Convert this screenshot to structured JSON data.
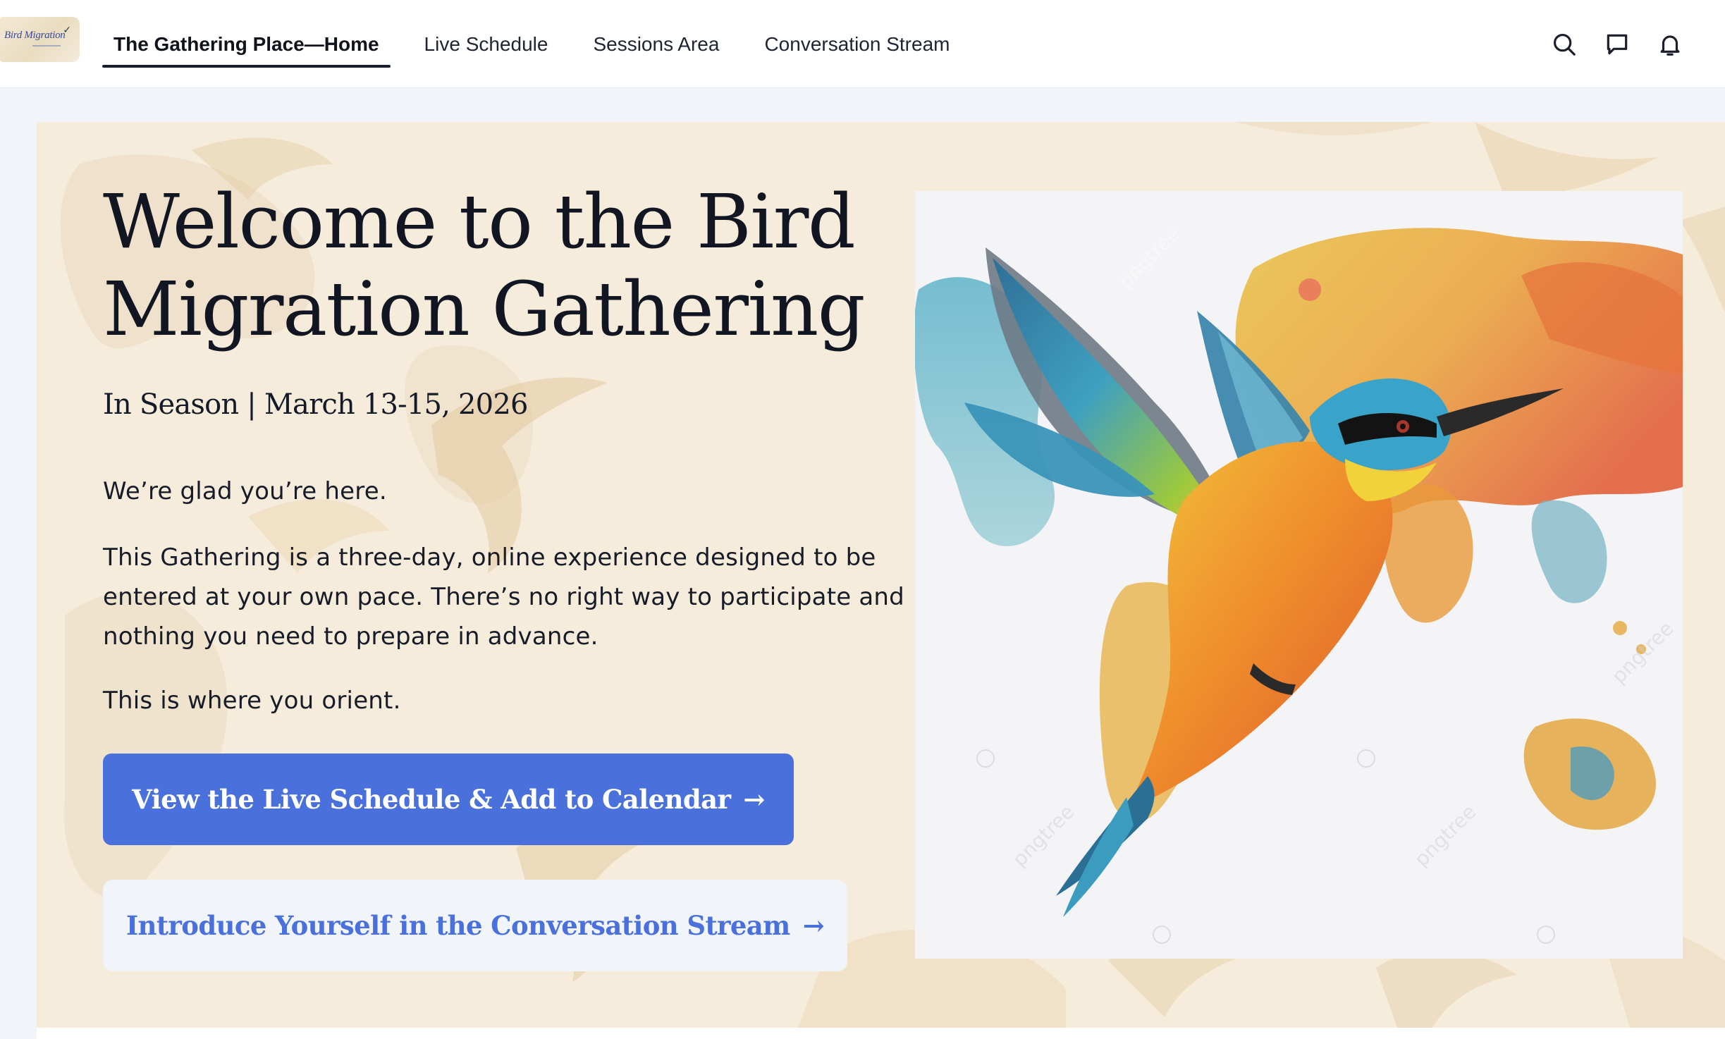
{
  "logo": {
    "text": "Bird Migration",
    "icon": "bird-icon"
  },
  "nav": {
    "tabs": [
      {
        "label": "The Gathering Place—Home",
        "active": true
      },
      {
        "label": "Live Schedule",
        "active": false
      },
      {
        "label": "Sessions Area",
        "active": false
      },
      {
        "label": "Conversation Stream",
        "active": false
      }
    ],
    "icons": [
      "search-icon",
      "chat-icon",
      "bell-icon"
    ]
  },
  "hero": {
    "title": "Welcome to the Bird Migration Gathering",
    "dates": "In Season | March 13-15, 2026",
    "greeting": "We’re glad you’re here.",
    "description": "This Gathering is a three-day, online experience designed to be entered at your own pace. There’s no right way to participate and nothing you need to prepare in advance.",
    "orient": "This is where you orient.",
    "primary_button": "View the Live Schedule & Add to Calendar",
    "secondary_button": "Introduce Yourself in the Conversation Stream",
    "arrow": "→",
    "image_watermark": "pngtree"
  },
  "colors": {
    "accent": "#4a70dc",
    "hero_bg": "#f5ecdc",
    "page_bg": "#f1f4f8",
    "text": "#151a28"
  }
}
